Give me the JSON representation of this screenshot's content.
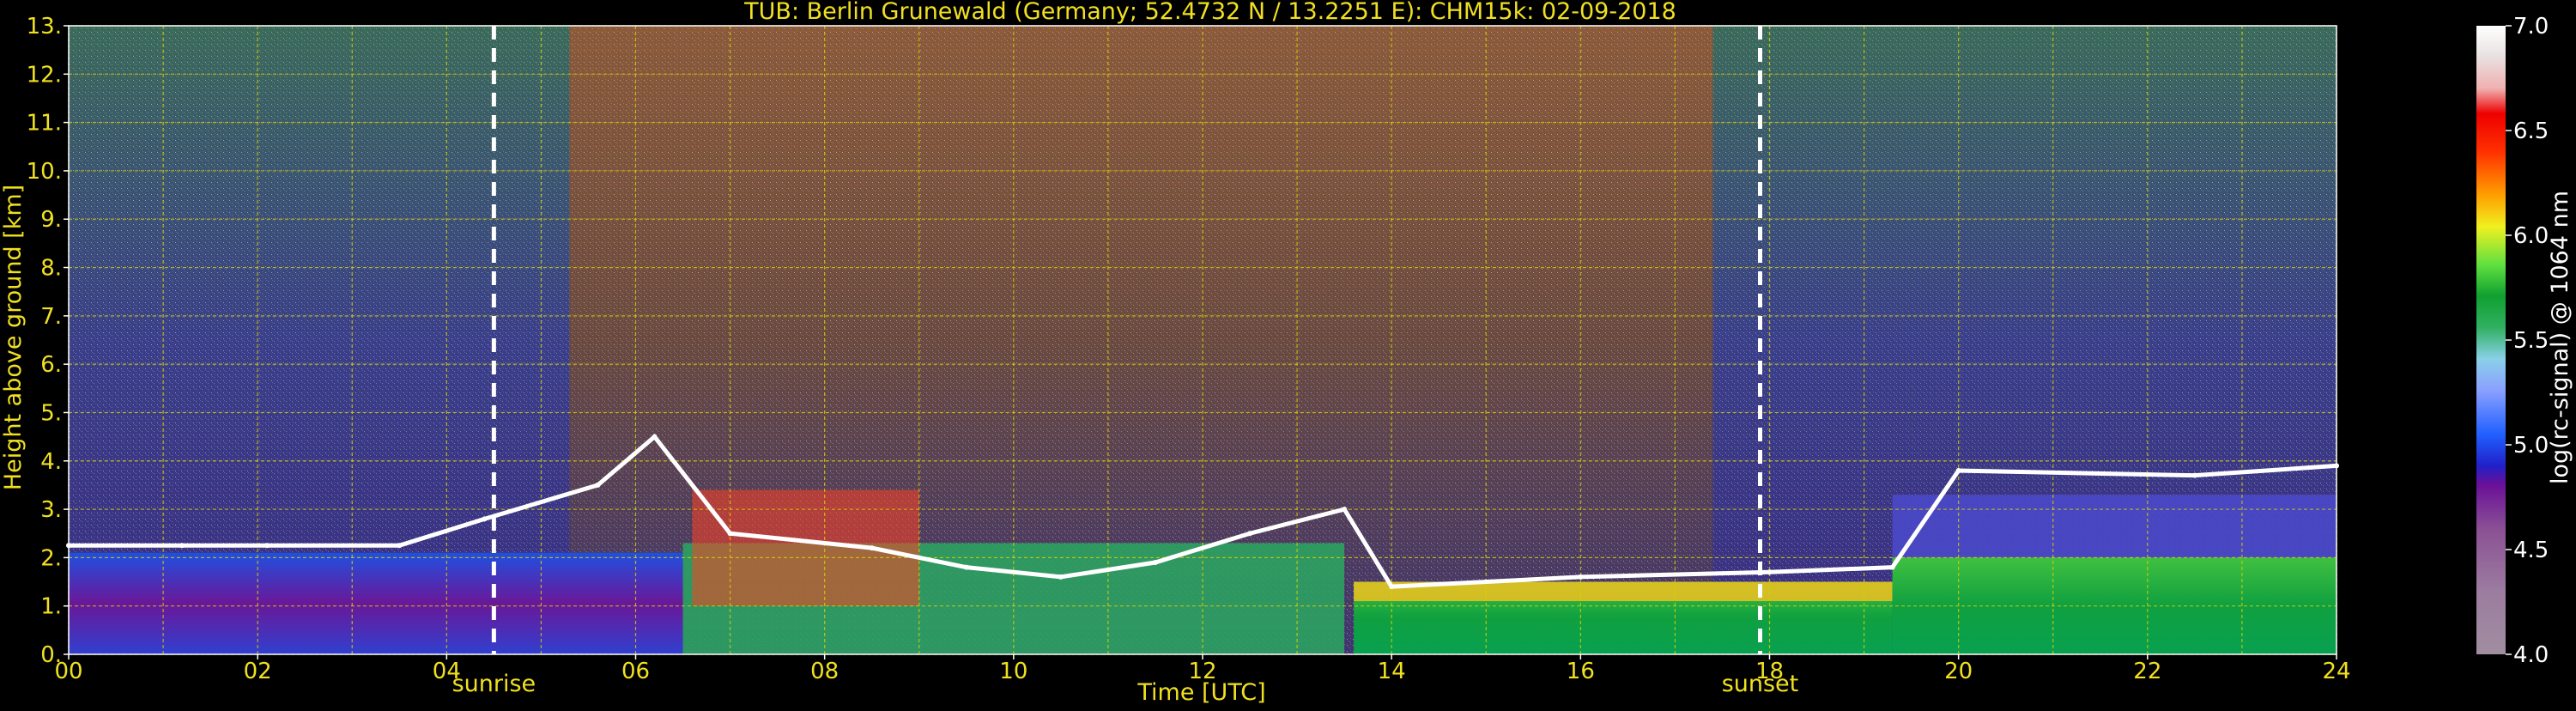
{
  "chart_data": {
    "type": "heatmap",
    "title": "TUB: Berlin Grunewald (Germany; 52.4732 N / 13.2251 E):    CHM15k: 02-09-2018",
    "xlabel": "Time [UTC]",
    "ylabel": "Height above ground [km]",
    "xlim": [
      0,
      24
    ],
    "ylim": [
      0,
      13
    ],
    "x_ticks": [
      "00",
      "02",
      "04",
      "06",
      "08",
      "10",
      "12",
      "14",
      "16",
      "18",
      "20",
      "22",
      "24"
    ],
    "y_ticks": [
      "0.",
      "1.",
      "2.",
      "3.",
      "4.",
      "5.",
      "6.",
      "7.",
      "8.",
      "9.",
      "10.",
      "11.",
      "12.",
      "13."
    ],
    "grid": true,
    "colorbar": {
      "label": "log(rc-signal) @ 1064 nm",
      "range": [
        4.0,
        7.0
      ],
      "ticks": [
        "4.0",
        "4.5",
        "5.0",
        "5.5",
        "6.0",
        "6.5",
        "7.0"
      ]
    },
    "annotations": [
      {
        "label": "sunrise",
        "time": 4.5
      },
      {
        "label": "sunset",
        "time": 17.9
      }
    ],
    "features": {
      "cloud_base_height_km": [
        {
          "t": 0.0,
          "h": 2.25
        },
        {
          "t": 1.2,
          "h": 2.25
        },
        {
          "t": 2.1,
          "h": 2.25
        },
        {
          "t": 3.5,
          "h": 2.25
        },
        {
          "t": 4.4,
          "h": 2.8
        },
        {
          "t": 5.6,
          "h": 3.5
        },
        {
          "t": 6.2,
          "h": 4.5
        },
        {
          "t": 7.0,
          "h": 2.5
        },
        {
          "t": 8.5,
          "h": 2.2
        },
        {
          "t": 9.5,
          "h": 1.8
        },
        {
          "t": 10.5,
          "h": 1.6
        },
        {
          "t": 11.5,
          "h": 1.9
        },
        {
          "t": 12.5,
          "h": 2.5
        },
        {
          "t": 13.5,
          "h": 3.0
        },
        {
          "t": 14.0,
          "h": 1.4
        },
        {
          "t": 16.0,
          "h": 1.6
        },
        {
          "t": 18.0,
          "h": 1.7
        },
        {
          "t": 19.3,
          "h": 1.8
        },
        {
          "t": 20.0,
          "h": 3.8
        },
        {
          "t": 22.5,
          "h": 3.7
        },
        {
          "t": 24.0,
          "h": 3.9
        }
      ]
    }
  }
}
